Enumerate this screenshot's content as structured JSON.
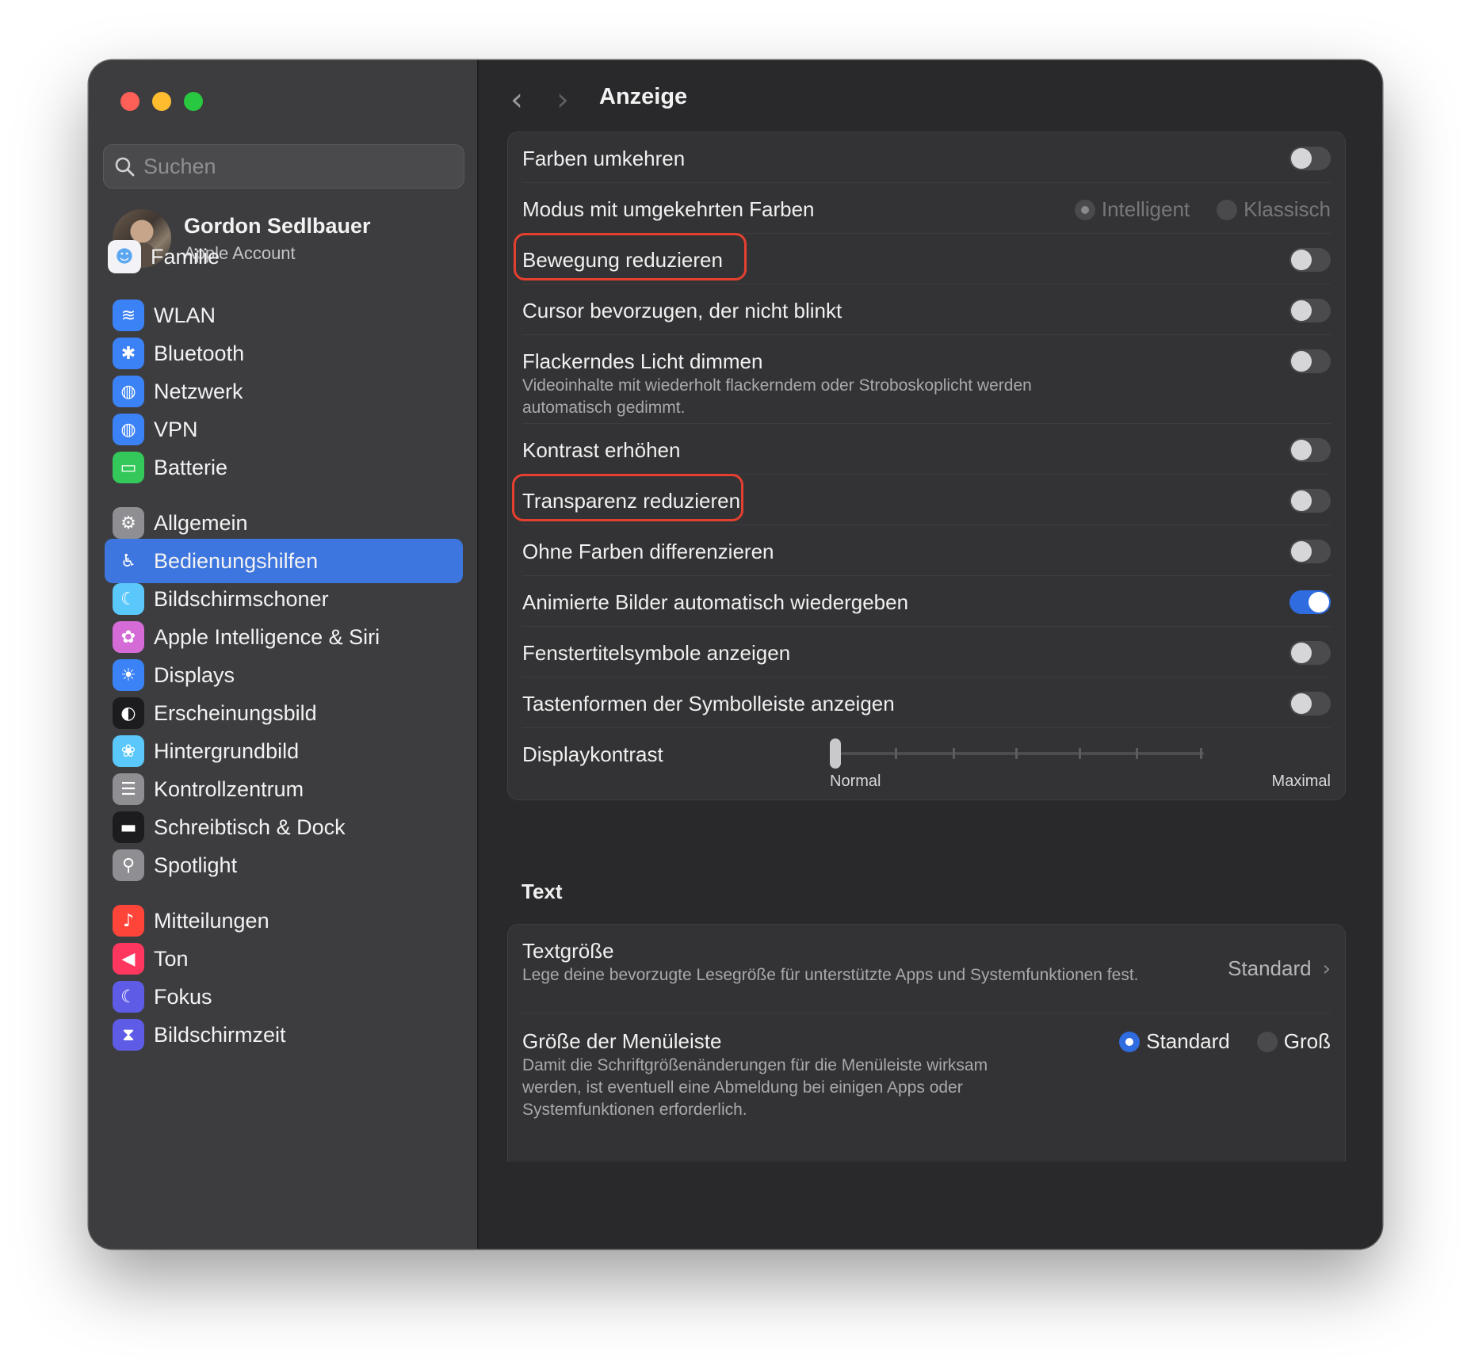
{
  "search": {
    "placeholder": "Suchen"
  },
  "account": {
    "name": "Gordon Sedlbauer",
    "subtitle": "Apple Account"
  },
  "sidebar": {
    "familie": "Familie",
    "items": [
      {
        "label": "WLAN",
        "icon": "wifi-icon",
        "glyph": "≋",
        "color": "#3b82f6"
      },
      {
        "label": "Bluetooth",
        "icon": "bluetooth-icon",
        "glyph": "✱",
        "color": "#3b82f6"
      },
      {
        "label": "Netzwerk",
        "icon": "globe-icon",
        "glyph": "◍",
        "color": "#3b82f6"
      },
      {
        "label": "VPN",
        "icon": "vpn-globe-icon",
        "glyph": "◍",
        "color": "#3b82f6"
      },
      {
        "label": "Batterie",
        "icon": "battery-icon",
        "glyph": "▭",
        "color": "#34c759"
      },
      {
        "label": "Allgemein",
        "icon": "gear-icon",
        "glyph": "⚙",
        "color": "#8e8e93"
      },
      {
        "label": "Bedienungshilfen",
        "icon": "accessibility-icon",
        "glyph": "♿",
        "color": "#2f6ce0"
      },
      {
        "label": "Bildschirmschoner",
        "icon": "screensaver-icon",
        "glyph": "☾",
        "color": "#5ac8fa"
      },
      {
        "label": "Apple Intelligence & Siri",
        "icon": "siri-icon",
        "glyph": "✿",
        "color": "#d46bd6"
      },
      {
        "label": "Displays",
        "icon": "sun-icon",
        "glyph": "☀",
        "color": "#3b82f6"
      },
      {
        "label": "Erscheinungsbild",
        "icon": "appearance-icon",
        "glyph": "◐",
        "color": "#1c1c1e"
      },
      {
        "label": "Hintergrundbild",
        "icon": "flower-icon",
        "glyph": "❀",
        "color": "#5ac8fa"
      },
      {
        "label": "Kontrollzentrum",
        "icon": "control-center-icon",
        "glyph": "☰",
        "color": "#8e8e93"
      },
      {
        "label": "Schreibtisch & Dock",
        "icon": "dock-icon",
        "glyph": "▬",
        "color": "#1c1c1e"
      },
      {
        "label": "Spotlight",
        "icon": "spotlight-search-icon",
        "glyph": "⚲",
        "color": "#8e8e93"
      },
      {
        "label": "Mitteilungen",
        "icon": "bell-icon",
        "glyph": "♪",
        "color": "#ff453a"
      },
      {
        "label": "Ton",
        "icon": "speaker-icon",
        "glyph": "◀",
        "color": "#ff375f"
      },
      {
        "label": "Fokus",
        "icon": "moon-icon",
        "glyph": "☾",
        "color": "#5e5ce6"
      },
      {
        "label": "Bildschirmzeit",
        "icon": "hourglass-icon",
        "glyph": "⧗",
        "color": "#5e5ce6"
      }
    ]
  },
  "header": {
    "title": "Anzeige"
  },
  "display": {
    "invert_colors": "Farben umkehren",
    "invert_mode": "Modus mit umgekehrten Farben",
    "invert_mode_options": [
      "Intelligent",
      "Klassisch"
    ],
    "reduce_motion": "Bewegung reduzieren",
    "non_blinking_cursor": "Cursor bevorzugen, der nicht blinkt",
    "dim_flashing": "Flackerndes Licht dimmen",
    "dim_flashing_desc": "Videoinhalte mit wiederholt flackerndem oder Stroboskoplicht werden automatisch gedimmt.",
    "increase_contrast": "Kontrast erhöhen",
    "reduce_transparency": "Transparenz reduzieren",
    "differentiate_without_color": "Ohne Farben differenzieren",
    "autoplay_animated": "Animierte Bilder automatisch wiedergeben",
    "window_title_icons": "Fenstertitelsymbole anzeigen",
    "toolbar_button_shapes": "Tastenformen der Symbolleiste anzeigen",
    "display_contrast": "Displaykontrast",
    "contrast_min": "Normal",
    "contrast_max": "Maximal",
    "contrast_level": 0
  },
  "text_section": {
    "title": "Text",
    "text_size": "Textgröße",
    "text_size_desc": "Lege deine bevorzugte Lesegröße für unterstützte Apps und Systemfunktionen fest.",
    "text_size_value": "Standard",
    "menubar_size": "Größe der Menüleiste",
    "menubar_size_desc": "Damit die Schriftgrößenänderungen für die Menüleiste wirksam werden, ist eventuell eine Abmeldung bei einigen Apps oder Systemfunktionen erforderlich.",
    "menubar_options": [
      "Standard",
      "Groß"
    ]
  }
}
